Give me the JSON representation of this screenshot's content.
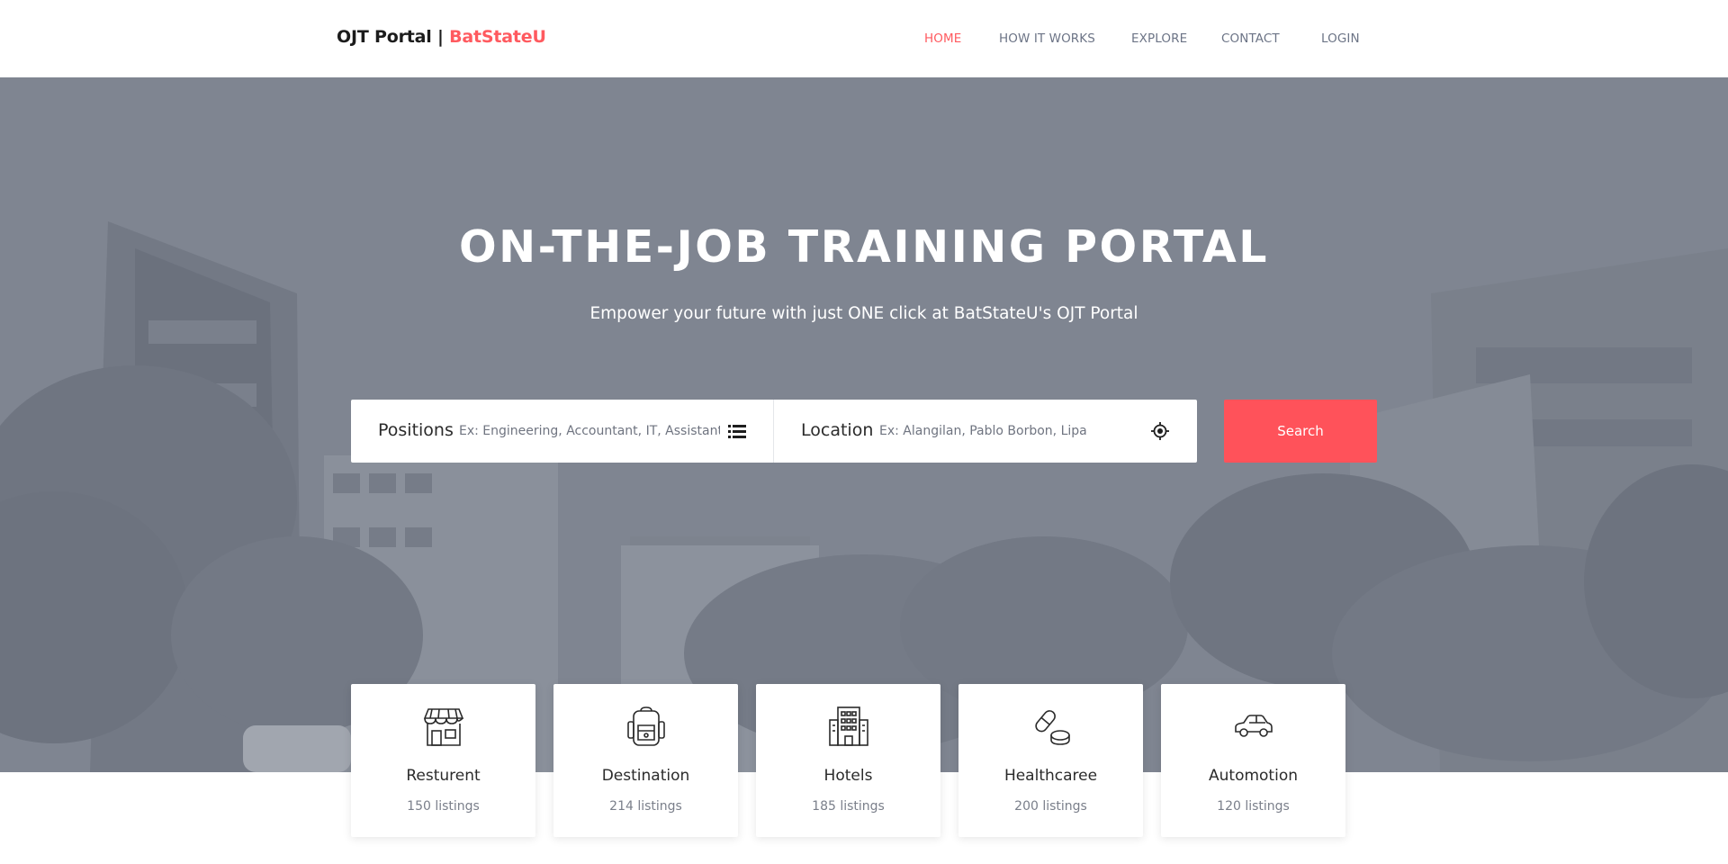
{
  "brand": {
    "name": "OJT Portal |",
    "accent": "BatStateU",
    "accent_color": "#ff5a5f"
  },
  "nav": {
    "items": [
      {
        "label": "HOME",
        "active": true
      },
      {
        "label": "HOW IT WORKS",
        "active": false
      },
      {
        "label": "EXPLORE",
        "active": false
      },
      {
        "label": "CONTACT",
        "active": false
      },
      {
        "label": "LOGIN",
        "active": false
      }
    ]
  },
  "hero": {
    "title": "ON-THE-JOB TRAINING PORTAL",
    "subtitle": "Empower your future with just ONE click at BatStateU's OJT Portal"
  },
  "search": {
    "positions_label": "Positions",
    "positions_placeholder": "Ex: Engineering, Accountant, IT, Assistant",
    "positions_icon": "list-icon",
    "location_label": "Location",
    "location_placeholder": "Ex: Alangilan, Pablo Borbon, Lipa",
    "location_icon": "locate-icon",
    "button_label": "Search",
    "button_color": "#ff525a"
  },
  "categories": [
    {
      "name": "Resturent",
      "count": "150 listings",
      "icon": "store-icon"
    },
    {
      "name": "Destination",
      "count": "214 listings",
      "icon": "backpack-icon"
    },
    {
      "name": "Hotels",
      "count": "185 listings",
      "icon": "building-icon"
    },
    {
      "name": "Healthcaree",
      "count": "200 listings",
      "icon": "pill-icon"
    },
    {
      "name": "Automotion",
      "count": "120 listings",
      "icon": "car-icon"
    }
  ]
}
